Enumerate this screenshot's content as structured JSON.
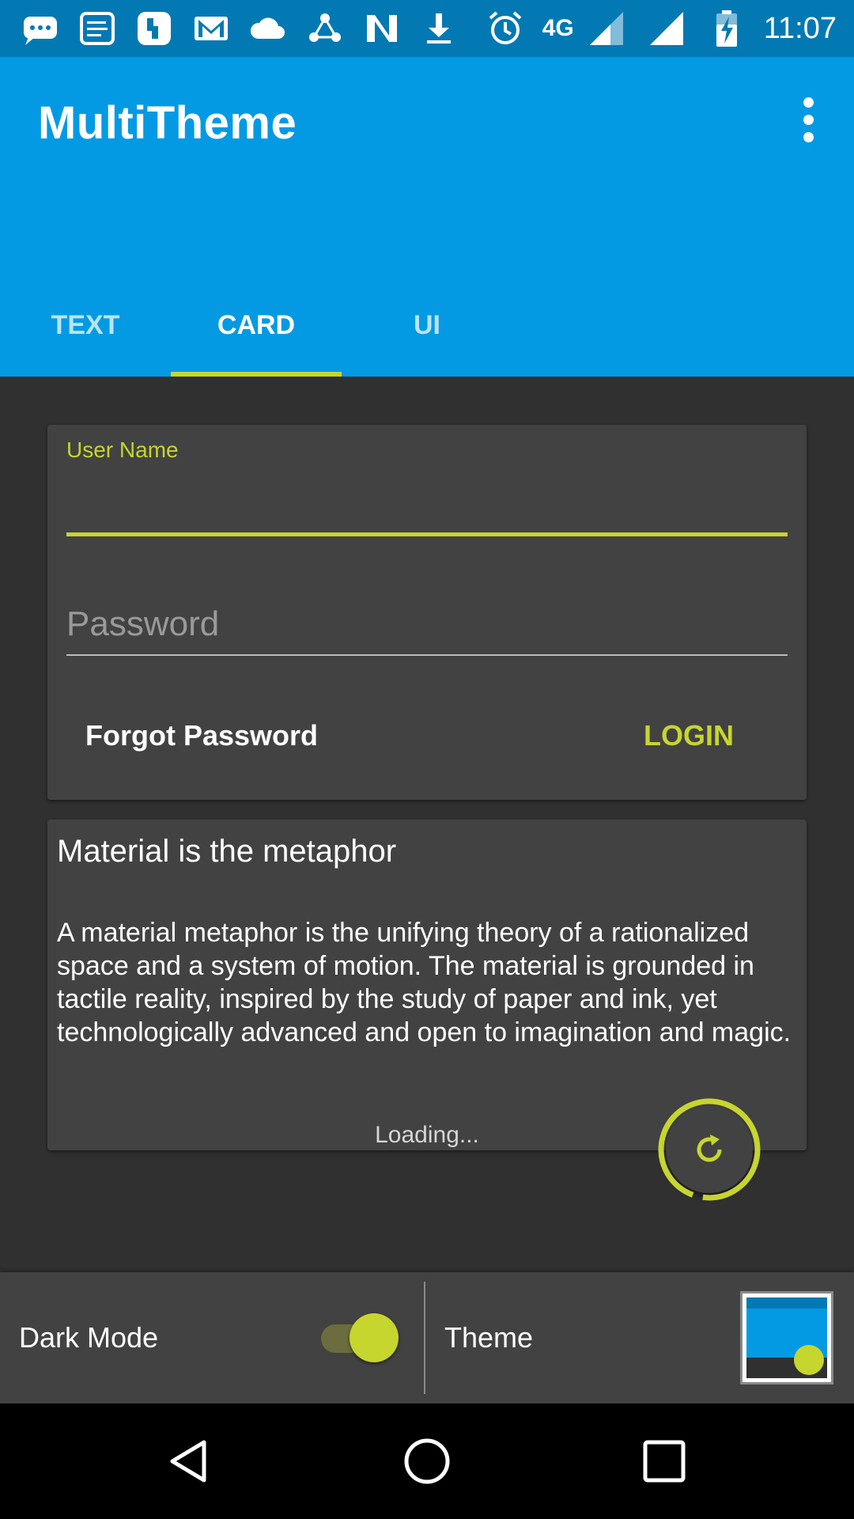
{
  "status_bar": {
    "icons": [
      "chat-icon",
      "notes-icon",
      "app-icon",
      "gmail-icon",
      "cloud-icon",
      "share-icon",
      "n-icon",
      "download-icon"
    ],
    "network": "4G",
    "time": "11:07"
  },
  "app_bar": {
    "title": "MultiTheme",
    "menu_icon": "more-vert-icon"
  },
  "tabs": [
    {
      "label": "TEXT",
      "selected": false
    },
    {
      "label": "CARD",
      "selected": true
    },
    {
      "label": "UI",
      "selected": false
    }
  ],
  "login_card": {
    "username_label": "User Name",
    "username_value": "",
    "password_placeholder": "Password",
    "forgot_label": "Forgot Password",
    "login_label": "LOGIN"
  },
  "info_card": {
    "title": "Material is the metaphor",
    "body": "A material metaphor is the unifying theory of a rationalized space and a system of motion. The material is grounded in tactile reality, inspired by the study of paper and ink, yet  technologically advanced and open to imagination and magic.",
    "loading": "Loading..."
  },
  "fab": {
    "icon": "refresh-icon"
  },
  "bottom_panel": {
    "dark_mode_label": "Dark Mode",
    "dark_mode_on": true,
    "theme_label": "Theme"
  },
  "colors": {
    "primary": "#049ae3",
    "primary_dark": "#0279b3",
    "accent": "#c7d52f",
    "background": "#303030",
    "card": "#424242"
  },
  "nav_bar": {
    "icons": [
      "back-icon",
      "home-icon",
      "recents-icon"
    ]
  }
}
